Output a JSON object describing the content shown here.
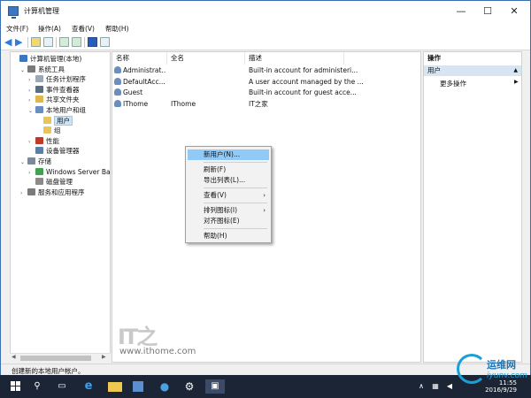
{
  "window": {
    "title": "计算机管理"
  },
  "window_buttons": {
    "minimize": "—",
    "maximize": "☐",
    "close": "✕"
  },
  "menu": [
    "文件(F)",
    "操作(A)",
    "查看(V)",
    "帮助(H)"
  ],
  "tree": [
    {
      "label": "计算机管理(本地)",
      "level": 0,
      "toggle": "",
      "icon_color": "#3a76c4"
    },
    {
      "label": "系统工具",
      "level": 1,
      "toggle": "⌄",
      "icon_color": "#7a7a7a"
    },
    {
      "label": "任务计划程序",
      "level": 2,
      "toggle": "›",
      "icon_color": "#9aa9b5"
    },
    {
      "label": "事件查看器",
      "level": 2,
      "toggle": "›",
      "icon_color": "#5b6d80"
    },
    {
      "label": "共享文件夹",
      "level": 2,
      "toggle": "›",
      "icon_color": "#e0b74a"
    },
    {
      "label": "本地用户和组",
      "level": 2,
      "toggle": "⌄",
      "icon_color": "#6a8fbf"
    },
    {
      "label": "用户",
      "level": 3,
      "toggle": "",
      "icon_color": "#e8c45a",
      "selected": true
    },
    {
      "label": "组",
      "level": 3,
      "toggle": "",
      "icon_color": "#e8c45a"
    },
    {
      "label": "性能",
      "level": 2,
      "toggle": "›",
      "icon_color": "#c0392b"
    },
    {
      "label": "设备管理器",
      "level": 2,
      "toggle": "",
      "icon_color": "#5a7ea8"
    },
    {
      "label": "存储",
      "level": 1,
      "toggle": "⌄",
      "icon_color": "#7a8a99"
    },
    {
      "label": "Windows Server Back",
      "level": 2,
      "toggle": "›",
      "icon_color": "#3fa34d"
    },
    {
      "label": "磁盘管理",
      "level": 2,
      "toggle": "",
      "icon_color": "#8a8a8a"
    },
    {
      "label": "服务和应用程序",
      "level": 1,
      "toggle": "›",
      "icon_color": "#7a7a7a"
    }
  ],
  "list": {
    "columns": [
      "名称",
      "全名",
      "描述"
    ],
    "rows": [
      {
        "name": "Administrat...",
        "fullname": "",
        "desc": "Built-in account for administeri..."
      },
      {
        "name": "DefaultAcc...",
        "fullname": "",
        "desc": "A user account managed by the ..."
      },
      {
        "name": "Guest",
        "fullname": "",
        "desc": "Built-in account for guest acce..."
      },
      {
        "name": "IThome",
        "fullname": "IThome",
        "desc": "IT之家"
      }
    ]
  },
  "context_menu": [
    {
      "label": "新用户(N)...",
      "highlight": true
    },
    {
      "sep": true
    },
    {
      "label": "刷新(F)"
    },
    {
      "label": "导出列表(L)..."
    },
    {
      "sep": true
    },
    {
      "label": "查看(V)",
      "submenu": true
    },
    {
      "sep": true
    },
    {
      "label": "排列图标(I)",
      "submenu": true
    },
    {
      "label": "对齐图标(E)"
    },
    {
      "sep": true
    },
    {
      "label": "帮助(H)"
    }
  ],
  "actions": {
    "header": "操作",
    "group": "用户",
    "group_arrow": "▲",
    "more": "更多操作",
    "more_arrow": "▶"
  },
  "status": "创建新的本地用户帐户。",
  "watermark": {
    "logo": "IT之",
    "site": "www.ithome.com"
  },
  "taskbar": {
    "time": "11:55",
    "date": "2016/9/29"
  },
  "badge": {
    "title": "运维网",
    "url": "iyunv.com"
  },
  "colors": {
    "accent": "#2d7be0",
    "highlight": "#91c9f7",
    "selection": "#cce4f7"
  }
}
